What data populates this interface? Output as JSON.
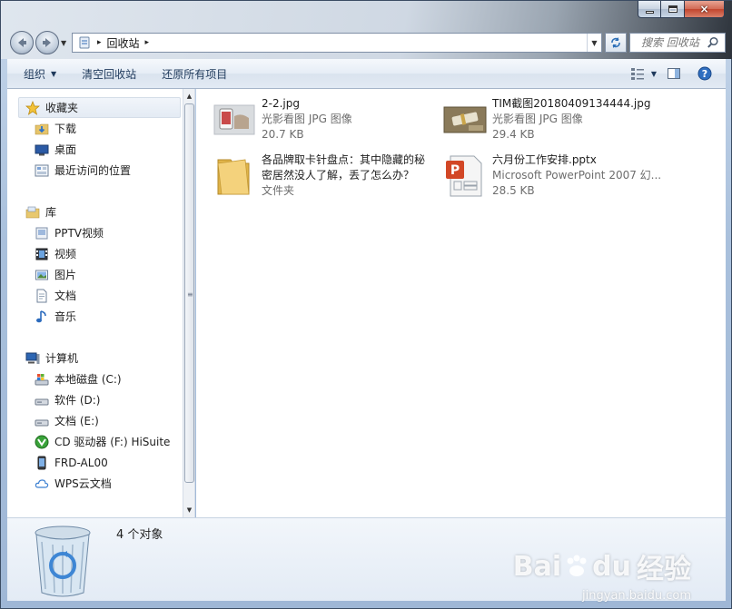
{
  "window": {
    "caption_buttons": {
      "minimize": "minimize",
      "maximize": "maximize",
      "close": "×"
    }
  },
  "address": {
    "path_sep": "▸",
    "location": "回收站",
    "dropdown_glyph": "▼"
  },
  "search": {
    "placeholder": "搜索 回收站"
  },
  "toolbar": {
    "organize_label": "组织",
    "empty_label": "清空回收站",
    "restore_all_label": "还原所有项目",
    "dropdown_glyph": "▼"
  },
  "sidebar": {
    "favorites": {
      "header": "收藏夹",
      "items": [
        {
          "label": "下载",
          "icon": "download-folder-icon"
        },
        {
          "label": "桌面",
          "icon": "desktop-icon"
        },
        {
          "label": "最近访问的位置",
          "icon": "recent-places-icon"
        }
      ]
    },
    "libraries": {
      "header": "库",
      "items": [
        {
          "label": "PPTV视频",
          "icon": "pptv-library-icon"
        },
        {
          "label": "视频",
          "icon": "video-library-icon"
        },
        {
          "label": "图片",
          "icon": "picture-library-icon"
        },
        {
          "label": "文档",
          "icon": "document-library-icon"
        },
        {
          "label": "音乐",
          "icon": "music-library-icon"
        }
      ]
    },
    "computer": {
      "header": "计算机",
      "items": [
        {
          "label": "本地磁盘 (C:)",
          "icon": "system-drive-icon"
        },
        {
          "label": "软件 (D:)",
          "icon": "drive-icon"
        },
        {
          "label": "文档 (E:)",
          "icon": "drive-icon"
        },
        {
          "label": "CD 驱动器 (F:) HiSuite",
          "icon": "cd-drive-icon"
        },
        {
          "label": "FRD-AL00",
          "icon": "phone-device-icon"
        },
        {
          "label": "WPS云文档",
          "icon": "cloud-icon"
        }
      ]
    }
  },
  "files": [
    {
      "name": "2-2.jpg",
      "type": "光影看图 JPG 图像",
      "size": "20.7 KB",
      "icon": "photo-thumbnail-icon"
    },
    {
      "name": "TIM截图20180409134444.jpg",
      "type": "光影看图 JPG 图像",
      "size": "29.4 KB",
      "icon": "photo-thumbnail-icon"
    },
    {
      "name_line1": "各品牌取卡针盘点：其中隐藏的秘",
      "name_line2": "密居然没人了解，丢了怎么办？",
      "type": "文件夹",
      "icon": "folder-icon"
    },
    {
      "name": "六月份工作安排.pptx",
      "type": "Microsoft PowerPoint 2007 幻...",
      "size": "28.5 KB",
      "icon": "powerpoint-file-icon"
    }
  ],
  "status": {
    "object_count": "4 个对象"
  },
  "watermark": {
    "brand": "Bai",
    "brand_tail": "du",
    "brand_cn": "经验",
    "url": "jingyan.baidu.com"
  }
}
